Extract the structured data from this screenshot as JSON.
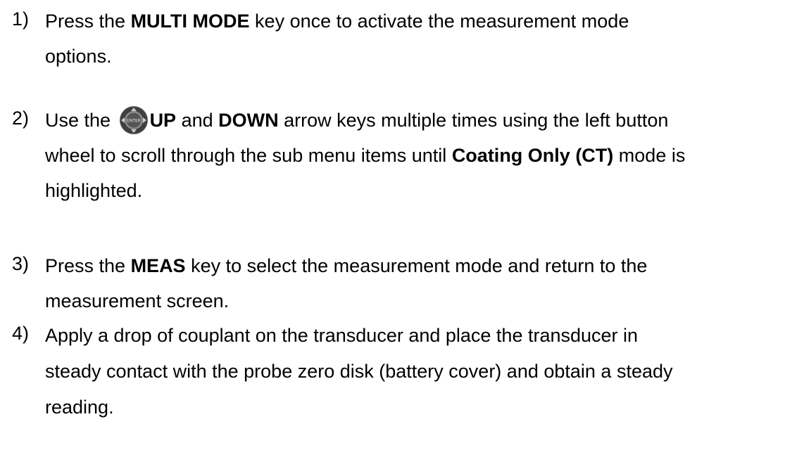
{
  "steps": [
    {
      "number": "1)",
      "lines": [
        {
          "pre": "Press the ",
          "key": "MULTI MODE",
          "post": " key once to activate the measurement mode"
        },
        {
          "text": "options."
        }
      ]
    },
    {
      "number": "2)",
      "lines": [
        {
          "pre": "Use the ",
          "icon": "dpad-enter-icon",
          "key1": "UP",
          "mid": " and ",
          "key2": "DOWN",
          "post": " arrow keys multiple times using the left button"
        },
        {
          "pre": "wheel to scroll through the sub menu items until ",
          "key": "Coating Only (CT)",
          "post": " mode is"
        },
        {
          "text": "highlighted."
        }
      ]
    },
    {
      "number": "3)",
      "lines": [
        {
          "pre": "Press the ",
          "key": "MEAS",
          "post": " key to select the measurement mode and return to the"
        },
        {
          "text": "measurement screen."
        }
      ]
    },
    {
      "number": "4)",
      "lines": [
        {
          "text": "Apply a drop of couplant on the transducer and place the transducer in"
        },
        {
          "text": "steady contact with the probe zero disk (battery cover) and obtain a steady"
        },
        {
          "text": "reading."
        }
      ]
    }
  ],
  "icons": {
    "dpad": {
      "name": "dpad-enter-icon",
      "center_label": "ENTER",
      "body_color": "#4a4a4a",
      "ring_color": "#8c8c8c"
    }
  }
}
